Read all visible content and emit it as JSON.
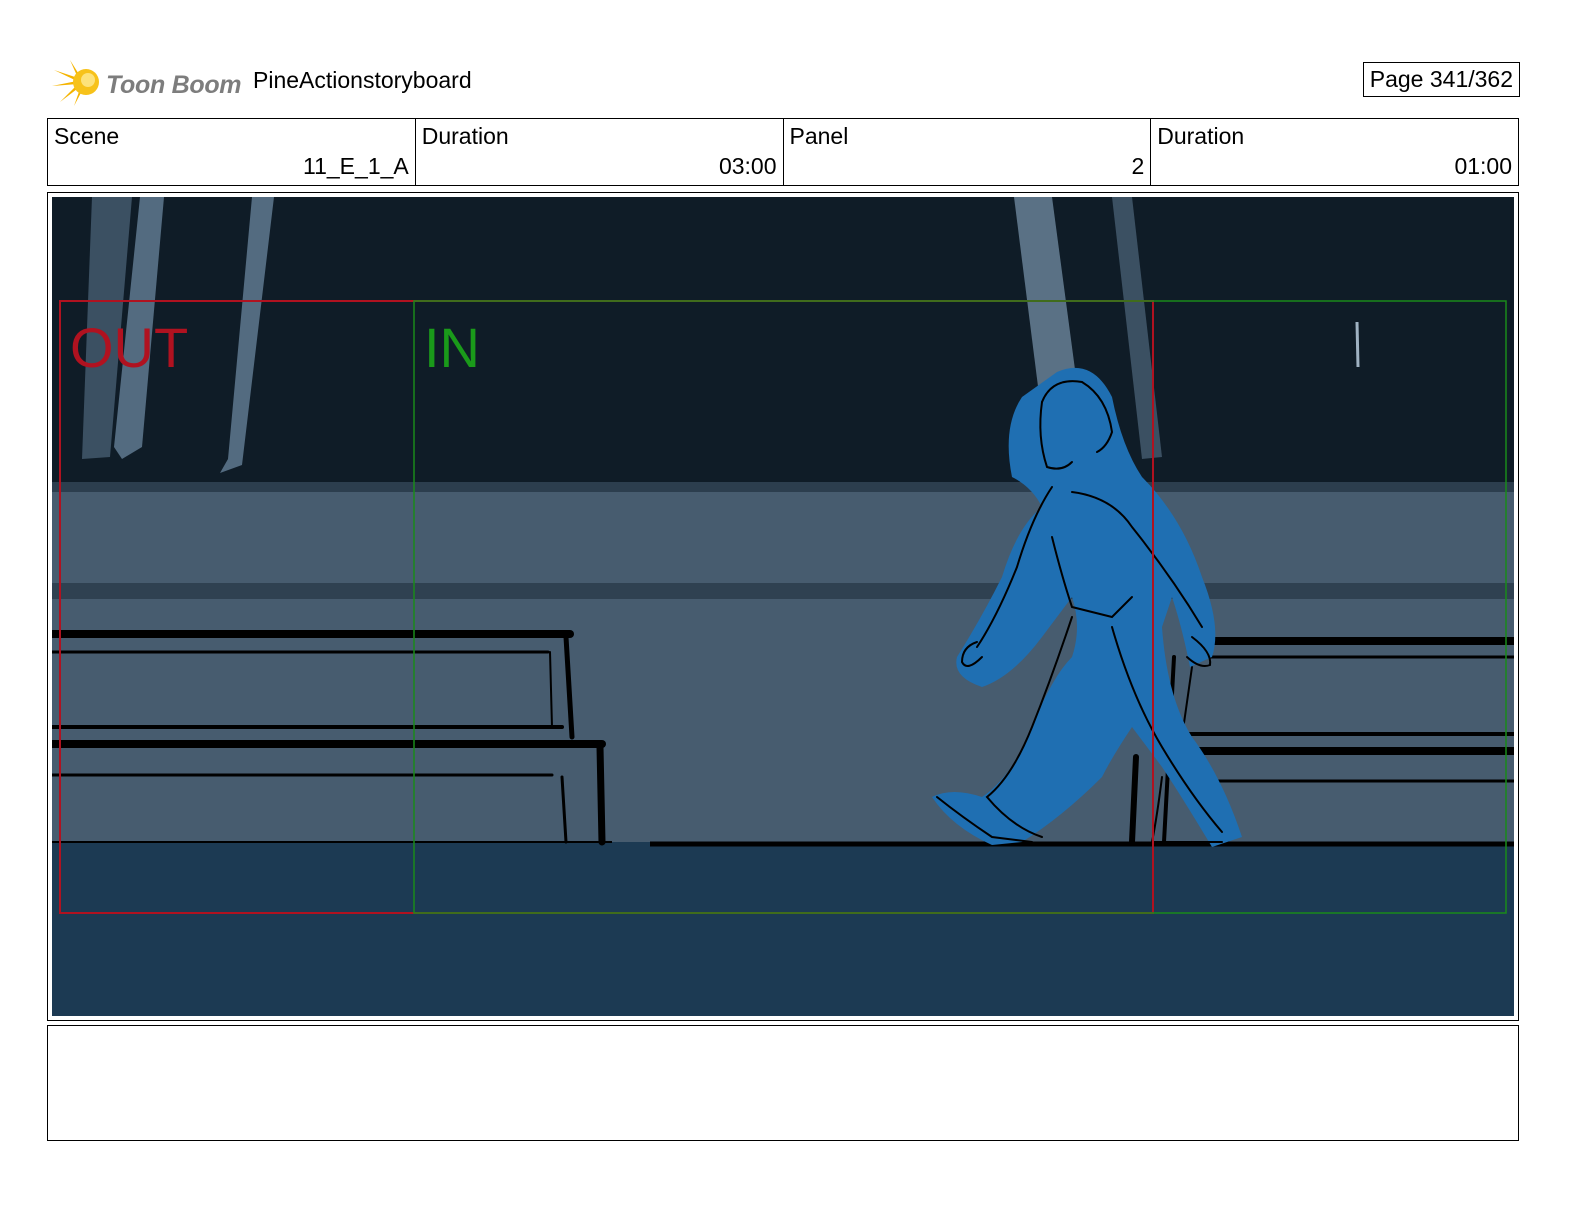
{
  "header": {
    "logo_text": "Toon Boom",
    "project_title": "PineActionstoryboard",
    "page": "Page 341/362"
  },
  "info": {
    "scene_label": "Scene",
    "scene_value": "11_E_1_A",
    "scene_duration_label": "Duration",
    "scene_duration_value": "03:00",
    "panel_label": "Panel",
    "panel_value": "2",
    "panel_duration_label": "Duration",
    "panel_duration_value": "01:00"
  },
  "panel": {
    "out_label": "OUT",
    "in_label": "IN",
    "colors": {
      "sky": "#0f1c27",
      "wall": "#475c6f",
      "floor": "#1c3a53",
      "character": "#1f6fb2",
      "out_frame": "#b01220",
      "in_frame": "#1a8a1a"
    }
  },
  "notes": {
    "text": ""
  }
}
